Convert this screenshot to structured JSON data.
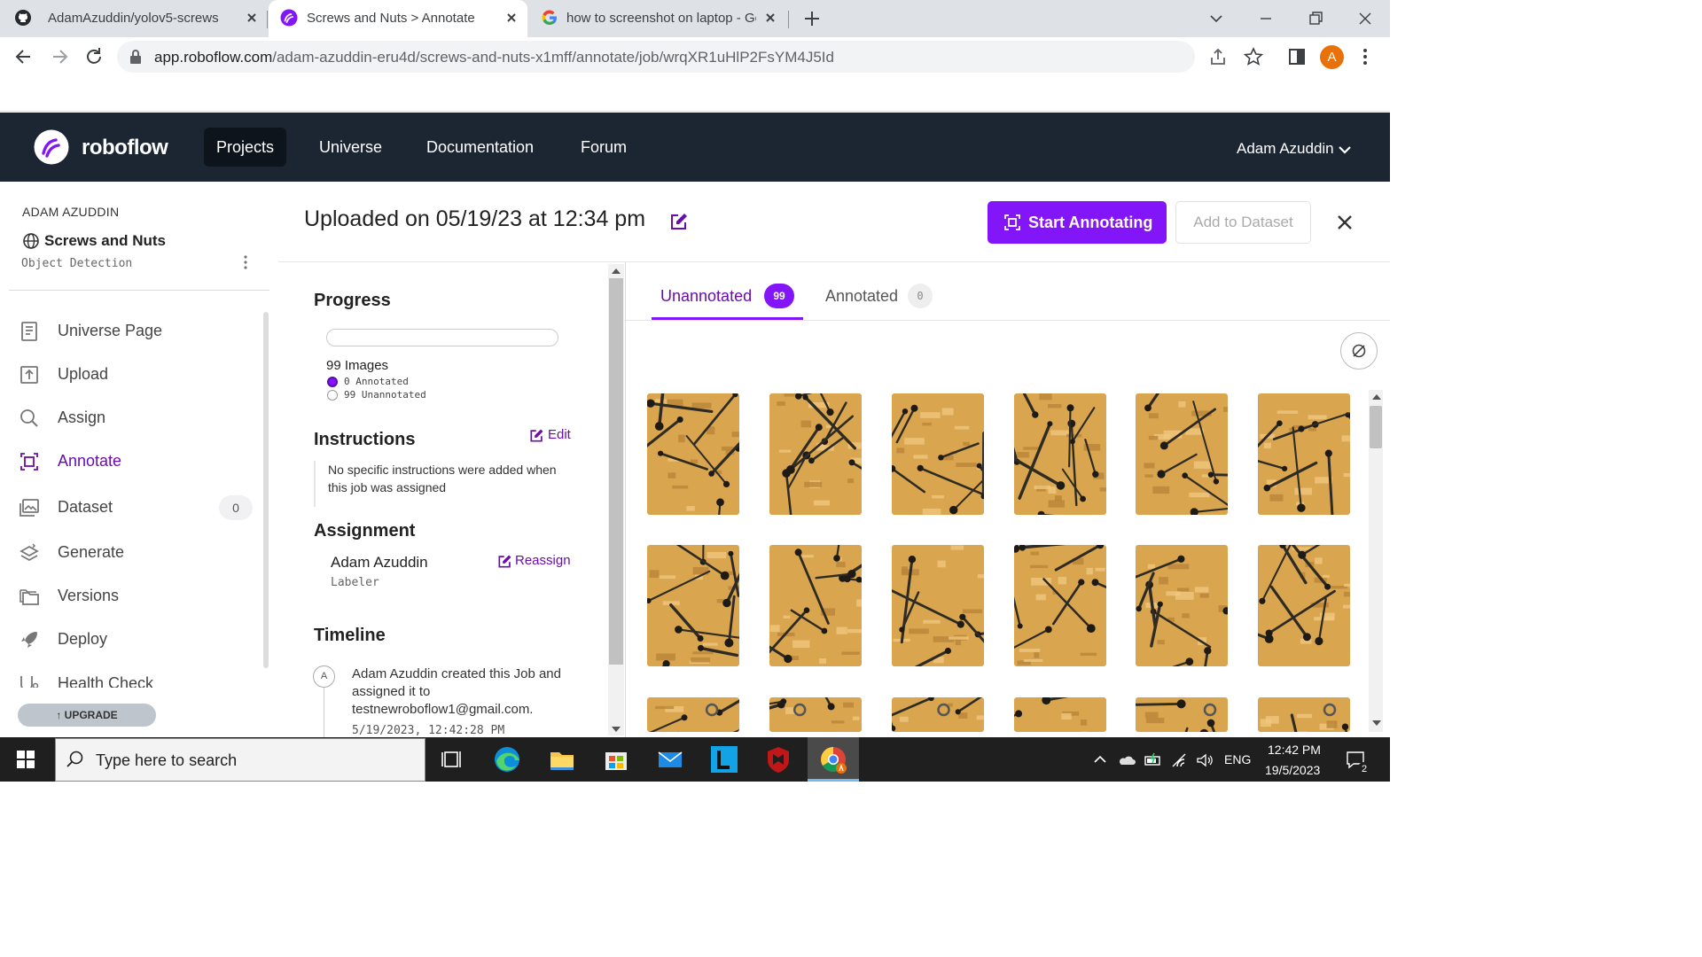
{
  "browser": {
    "tabs": [
      {
        "title": "AdamAzuddin/yolov5-screws",
        "icon": "github-icon",
        "active": false
      },
      {
        "title": "Screws and Nuts > Annotate",
        "icon": "roboflow-icon",
        "active": true
      },
      {
        "title": "how to screenshot on laptop - Go",
        "icon": "google-icon",
        "active": false
      }
    ],
    "url_host": "app.roboflow.com",
    "url_path": "/adam-azuddin-eru4d/screws-and-nuts-x1mff/annotate/job/wrqXR1uHlP2FsYM4J5Id",
    "profile_initial": "A",
    "profile_color": "#e8710a"
  },
  "app_nav": {
    "logo_text": "roboflow",
    "items": [
      "Projects",
      "Universe",
      "Documentation",
      "Forum"
    ],
    "active_item": "Projects",
    "user_name": "Adam Azuddin"
  },
  "sidebar": {
    "workspace_owner": "ADAM AZUDDIN",
    "project_name": "Screws and Nuts",
    "project_type": "Object Detection",
    "items": [
      {
        "label": "Universe Page",
        "icon": "book-icon"
      },
      {
        "label": "Upload",
        "icon": "upload-icon"
      },
      {
        "label": "Assign",
        "icon": "search-icon"
      },
      {
        "label": "Annotate",
        "icon": "annotate-icon",
        "active": true
      },
      {
        "label": "Dataset",
        "icon": "images-icon",
        "badge": "0"
      },
      {
        "label": "Generate",
        "icon": "layers-icon"
      },
      {
        "label": "Versions",
        "icon": "folders-icon"
      },
      {
        "label": "Deploy",
        "icon": "rocket-icon"
      },
      {
        "label": "Health Check",
        "icon": "health-icon"
      }
    ],
    "upgrade_label": "UPGRADE"
  },
  "job": {
    "title": "Uploaded on 05/19/23 at 12:34 pm",
    "start_button": "Start Annotating",
    "add_button": "Add to Dataset",
    "progress_heading": "Progress",
    "progress_fraction": 0,
    "image_count": "99 Images",
    "annotated_label": "0 Annotated",
    "unannotated_label": "99 Unannotated",
    "instructions_heading": "Instructions",
    "edit_label": "Edit",
    "instructions_text": "No specific instructions were added when this job was assigned",
    "assignment_heading": "Assignment",
    "reassign_label": "Reassign",
    "assignee_name": "Adam Azuddin",
    "assignee_role": "Labeler",
    "timeline_heading": "Timeline",
    "timeline_avatar": "A",
    "timeline_text": "Adam Azuddin created this Job and assigned it to testnewroboflow1@gmail.com.",
    "timeline_date": "5/19/2023, 12:42:28 PM"
  },
  "grid": {
    "tab_unannotated": "Unannotated",
    "count_unannotated": "99",
    "tab_annotated": "Annotated",
    "count_annotated": "0",
    "accent": "#8315f9"
  },
  "taskbar": {
    "search_placeholder": "Type here to search",
    "language": "ENG",
    "time": "12:42 PM",
    "date": "19/5/2023",
    "notification_count": "2"
  }
}
